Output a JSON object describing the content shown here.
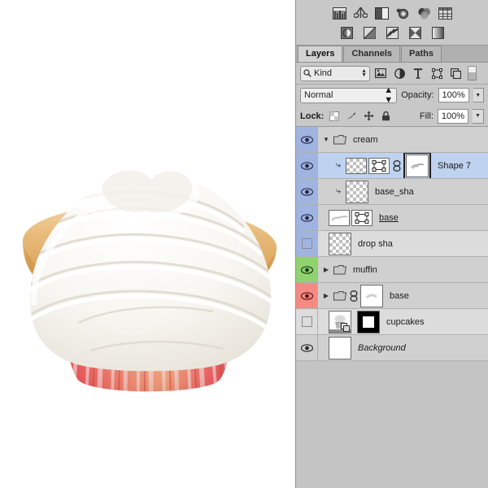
{
  "app": {
    "title": "Photoshop Layers Panel"
  },
  "adjustments": {
    "row1": [
      {
        "name": "levels-icon",
        "label": "Levels"
      },
      {
        "name": "curves-icon",
        "label": "Curves"
      },
      {
        "name": "brightness-contrast-icon",
        "label": "Brightness/Contrast"
      },
      {
        "name": "exposure-icon",
        "label": "Exposure"
      },
      {
        "name": "color-balance-icon",
        "label": "Color Balance"
      },
      {
        "name": "black-white-icon",
        "label": "Black & White"
      }
    ],
    "row2": [
      {
        "name": "invert-icon",
        "label": "Invert"
      },
      {
        "name": "posterize-icon",
        "label": "Posterize"
      },
      {
        "name": "threshold-icon",
        "label": "Threshold"
      },
      {
        "name": "selective-color-icon",
        "label": "Selective Color"
      },
      {
        "name": "gradient-map-icon",
        "label": "Gradient Map"
      }
    ]
  },
  "tabs": [
    {
      "label": "Layers",
      "active": true
    },
    {
      "label": "Channels",
      "active": false
    },
    {
      "label": "Paths",
      "active": false
    }
  ],
  "filter": {
    "kind_label": "Kind",
    "search_icon": "search-icon",
    "icons": [
      {
        "name": "filter-pixel-icon",
        "label": "Pixel Layers"
      },
      {
        "name": "filter-adjustment-icon",
        "label": "Adjustment Layers"
      },
      {
        "name": "filter-type-icon",
        "label": "Type Layers"
      },
      {
        "name": "filter-shape-icon",
        "label": "Shape Layers"
      },
      {
        "name": "filter-smart-object-icon",
        "label": "Smart Objects"
      }
    ],
    "toggle_name": "filter-enable-toggle"
  },
  "blend": {
    "mode": "Normal",
    "opacity_label": "Opacity:",
    "opacity_value": "100%",
    "fill_label": "Fill:",
    "fill_value": "100%"
  },
  "lock": {
    "label": "Lock:",
    "items": [
      {
        "name": "lock-transparency-icon",
        "label": "Lock transparent pixels"
      },
      {
        "name": "lock-image-icon",
        "label": "Lock image pixels"
      },
      {
        "name": "lock-position-icon",
        "label": "Lock position"
      },
      {
        "name": "lock-all-icon",
        "label": "Lock all"
      }
    ]
  },
  "layers": [
    {
      "name": "cream",
      "type": "group",
      "visible": true,
      "eye_color": "#9fb4e0",
      "expanded": true,
      "selected": false,
      "indent": 0,
      "clipped": false,
      "italic": false,
      "underline": false,
      "thumbs": []
    },
    {
      "name": "Shape 7",
      "type": "shape",
      "visible": true,
      "eye_color": "#9fb4e0",
      "expanded": null,
      "selected": true,
      "indent": 1,
      "clipped": true,
      "italic": false,
      "underline": false,
      "linked": true,
      "thumbs": [
        "layer",
        "vector-mask",
        "selected-mask"
      ]
    },
    {
      "name": "base_sha",
      "type": "pixel",
      "visible": true,
      "eye_color": "#9fb4e0",
      "expanded": null,
      "selected": false,
      "indent": 1,
      "clipped": true,
      "italic": false,
      "underline": false,
      "thumbs": [
        "transparent"
      ]
    },
    {
      "name": "base",
      "type": "shape",
      "visible": true,
      "eye_color": "#9fb4e0",
      "expanded": null,
      "selected": false,
      "indent": 0,
      "clipped": false,
      "italic": false,
      "underline": true,
      "thumbs": [
        "layer-white",
        "vector-mask"
      ]
    },
    {
      "name": "drop sha",
      "type": "pixel",
      "visible": false,
      "eye_color": "#9fb4e0",
      "expanded": null,
      "selected": false,
      "indent": 0,
      "clipped": false,
      "italic": false,
      "underline": false,
      "thumbs": [
        "transparent"
      ]
    },
    {
      "name": "muffin",
      "type": "group",
      "visible": true,
      "eye_color": "#8ed36f",
      "expanded": false,
      "selected": false,
      "indent": 0,
      "clipped": false,
      "italic": false,
      "underline": false,
      "thumbs": []
    },
    {
      "name": "base",
      "type": "group",
      "visible": true,
      "eye_color": "#f58a83",
      "expanded": false,
      "selected": false,
      "indent": 0,
      "clipped": false,
      "italic": false,
      "underline": false,
      "linked": true,
      "thumbs": [
        "mask-white"
      ]
    },
    {
      "name": "cupcakes",
      "type": "smart-object",
      "visible": false,
      "eye_color": "#dcdcdc",
      "expanded": null,
      "selected": false,
      "indent": 0,
      "clipped": false,
      "italic": false,
      "underline": false,
      "thumbs": [
        "cupcake-photo",
        "mask-black"
      ]
    },
    {
      "name": "Background",
      "type": "background",
      "visible": true,
      "eye_color": "#d0d0d0",
      "expanded": null,
      "selected": false,
      "indent": 0,
      "clipped": false,
      "italic": true,
      "underline": false,
      "thumbs": [
        "layer-white-plain"
      ]
    }
  ],
  "canvas": {
    "artwork": "cupcake-with-white-frosting-and-red-striped-liner",
    "frosting_color": "#f7f5f1",
    "muffin_color": "#e8bc7d",
    "liner_color": "#ef4a4a",
    "background": "#ffffff"
  },
  "colors": {
    "panel_bg": "#c4c4c4",
    "row_bg": "#d0d0d0",
    "row_selected": "#bfd2ef",
    "eye_blue": "#9fb4e0",
    "eye_green": "#8ed36f",
    "eye_red": "#f58a83"
  }
}
